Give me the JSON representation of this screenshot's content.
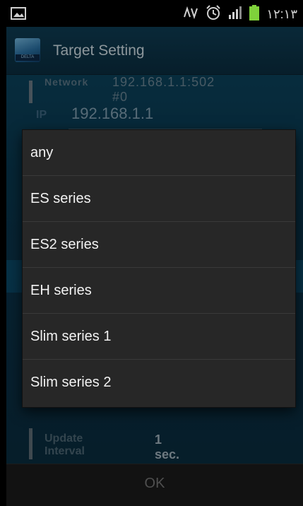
{
  "statusbar": {
    "time": "۱۲:۱۳"
  },
  "app": {
    "title": "Target Setting",
    "logo_text": "DELTA"
  },
  "form": {
    "network_label": "Network",
    "network_value": "192.168.1.1:502 #0",
    "ip_label": "IP",
    "ip_value": "192.168.1.1",
    "update_label": "Update Interval",
    "update_value": "1 sec."
  },
  "dialog": {
    "options": [
      "any",
      "ES series",
      "ES2 series",
      "EH series",
      "Slim series 1",
      "Slim series 2"
    ]
  },
  "footer": {
    "ok_label": "OK"
  }
}
